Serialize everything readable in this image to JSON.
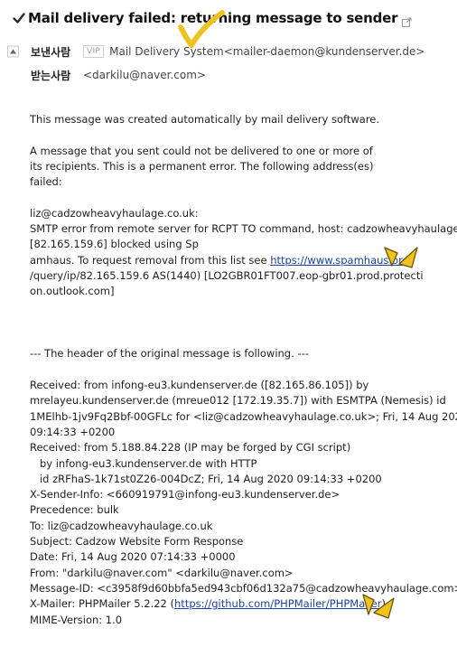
{
  "subject": "Mail delivery failed: returning message to sender",
  "sender": {
    "label": "보낸사람",
    "badge": "VIP",
    "name": "Mail Delivery System",
    "address": "<mailer-daemon@kundenserver.de>"
  },
  "recipient": {
    "label": "받는사람",
    "address": "<darkilu@naver.com>"
  },
  "body_lines": [
    [
      {
        "t": "This message was created automatically by mail delivery software."
      }
    ],
    [],
    [
      {
        "t": "A message that you sent could not be delivered to one or more of"
      }
    ],
    [
      {
        "t": "its recipients. This is a permanent error. The following address(es)"
      }
    ],
    [
      {
        "t": "failed:"
      }
    ],
    [],
    [
      {
        "t": "liz@cadzowheavyhaulage.co.uk:"
      }
    ],
    [
      {
        "t": "SMTP error from remote server for RCPT TO command, host: cadzowheavyhaulage-co"
      }
    ],
    [
      {
        "t": "[82.165.159.6] blocked using Sp"
      }
    ],
    [
      {
        "t": "amhaus. To request removal from this list see "
      },
      {
        "t": "https://www.spamhaus.org",
        "link": true
      }
    ],
    [
      {
        "t": "/query/ip/82.165.159.6 AS(1440) [LO2GBR01FT007.eop-gbr01.prod.protecti"
      }
    ],
    [
      {
        "t": "on.outlook.com]"
      }
    ],
    [],
    [],
    [],
    [
      {
        "t": "--- The header of the original message is following. ---"
      }
    ],
    [],
    [
      {
        "t": "Received: from infong-eu3.kundenserver.de ([82.165.86.105]) by"
      }
    ],
    [
      {
        "t": "mrelayeu.kundenserver.de (mreue012 [172.19.35.7]) with ESMTPA (Nemesis) id"
      }
    ],
    [
      {
        "t": "1MElhb-1jv9Fq2Bbf-00GFLc for <liz@cadzowheavyhaulage.co.uk>; Fri, 14 Aug 2020"
      }
    ],
    [
      {
        "t": "09:14:33 +0200"
      }
    ],
    [
      {
        "t": "Received: from 5.188.84.228 (IP may be forged by CGI script)"
      }
    ],
    [
      {
        "t": "   by infong-eu3.kundenserver.de with HTTP"
      }
    ],
    [
      {
        "t": "   id zRFhaS-1k71st0Z26-004DcZ; Fri, 14 Aug 2020 09:14:33 +0200"
      }
    ],
    [
      {
        "t": "X-Sender-Info: <660919791@infong-eu3.kundenserver.de>"
      }
    ],
    [
      {
        "t": "Precedence: bulk"
      }
    ],
    [
      {
        "t": "To: liz@cadzowheavyhaulage.co.uk"
      }
    ],
    [
      {
        "t": "Subject: Cadzow Website Form Response"
      }
    ],
    [
      {
        "t": "Date: Fri, 14 Aug 2020 07:14:33 +0000"
      }
    ],
    [
      {
        "t": "From: \"darkilu@naver.com\" <darkilu@naver.com>"
      }
    ],
    [
      {
        "t": "Message-ID: <c3958f9d60bbfa5ed943cbf06d132a75@cadzowheavyhaulage.com>"
      }
    ],
    [
      {
        "t": "X-Mailer: PHPMailer 5.2.22 ("
      },
      {
        "t": "https://github.com/PHPMailer/PHPMailer",
        "link": true
      },
      {
        "t": ")"
      }
    ],
    [
      {
        "t": "MIME-Version: 1.0"
      }
    ]
  ],
  "colors": {
    "link": "#1a3fa6",
    "annotation": "#f2c21c"
  },
  "icons": {
    "subject_prefix": "check-icon",
    "subject_suffix": "popout-icon",
    "collapse": "triangle-up-icon"
  }
}
